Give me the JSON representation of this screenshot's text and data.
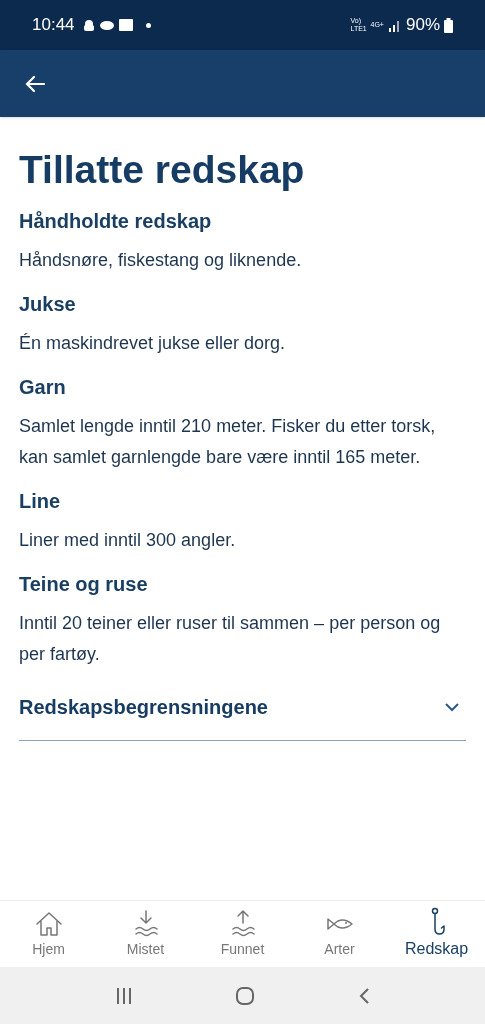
{
  "status_bar": {
    "time": "10:44",
    "network": [
      "Vo)",
      "LTE1",
      "4G+"
    ],
    "battery": "90%"
  },
  "title": "Tillatte redskap",
  "sections": [
    {
      "heading": "Håndholdte redskap",
      "text": "Håndsnøre, fiskestang og liknende."
    },
    {
      "heading": "Jukse",
      "text": "Én maskindrevet jukse eller dorg."
    },
    {
      "heading": "Garn",
      "text": "Samlet lengde inntil 210 meter. Fisker du etter torsk, kan samlet garnlengde bare være inntil 165 meter."
    },
    {
      "heading": "Line",
      "text": "Liner med inntil 300 angler."
    },
    {
      "heading": "Teine og ruse",
      "text": "Inntil 20 teiner eller ruser til sammen – per person og per fartøy."
    }
  ],
  "accordion": {
    "label": "Redskapsbegrensningene",
    "expanded": false
  },
  "bottom_nav": [
    {
      "kind": "home",
      "label": "Hjem",
      "selected": false
    },
    {
      "kind": "down",
      "label": "Mistet",
      "selected": false
    },
    {
      "kind": "up",
      "label": "Funnet",
      "selected": false
    },
    {
      "kind": "fish",
      "label": "Arter",
      "selected": false
    },
    {
      "kind": "hook",
      "label": "Redskap",
      "selected": true
    }
  ]
}
